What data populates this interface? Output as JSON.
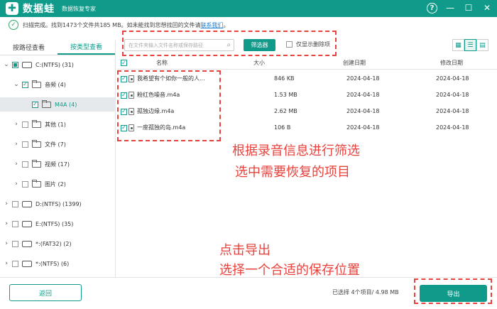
{
  "app": {
    "logo_char": "✚",
    "name": "数据蛙",
    "subtitle": "数据恢复专家",
    "accent": "#0f9a8a"
  },
  "window": {
    "help": "?",
    "minimize": "—",
    "maximize": "☐",
    "close": "✕"
  },
  "status": {
    "text": "扫描完成。找到1473个文件共185 MB。如未能找到您想找回的文件请",
    "link": "联系我们",
    "tail": "。"
  },
  "tabs": [
    "按路径查看",
    "按类型查看"
  ],
  "tree": [
    {
      "label": "C:(NTFS) (31)",
      "arrow": "v",
      "state": "partial",
      "icon": "drive"
    },
    {
      "label": "音频 (4)",
      "arrow": "v",
      "state": "checked",
      "icon": "folder"
    },
    {
      "label": "M4A (4)",
      "arrow": "",
      "state": "checked",
      "icon": "folder"
    },
    {
      "label": "其他 (1)",
      "arrow": ">",
      "state": "empty",
      "icon": "folder"
    },
    {
      "label": "文件 (7)",
      "arrow": ">",
      "state": "empty",
      "icon": "folder"
    },
    {
      "label": "视频 (17)",
      "arrow": ">",
      "state": "empty",
      "icon": "folder"
    },
    {
      "label": "图片 (2)",
      "arrow": ">",
      "state": "empty",
      "icon": "folder"
    },
    {
      "label": "D:(NTFS) (1399)",
      "arrow": ">",
      "state": "empty",
      "icon": "drive"
    },
    {
      "label": "E:(NTFS) (35)",
      "arrow": ">",
      "state": "empty",
      "icon": "drive"
    },
    {
      "label": "*:(FAT32) (2)",
      "arrow": ">",
      "state": "empty",
      "icon": "drive"
    },
    {
      "label": "*:(NTFS) (6)",
      "arrow": ">",
      "state": "empty",
      "icon": "drive"
    }
  ],
  "toolbar": {
    "search_placeholder": "在文件夹输入文件名称或保存路径",
    "filter_label": "筛选器",
    "show_deleted_label": "仅显示删除项"
  },
  "table": {
    "columns": [
      "名称",
      "大小",
      "创建日期",
      "修改日期"
    ],
    "rows": [
      {
        "name": "我希望有个如你一般的人...",
        "size": "846 KB",
        "created": "2024-04-18",
        "modified": "2024-04-18"
      },
      {
        "name": "粉红色噪音.m4a",
        "size": "1.53 MB",
        "created": "2024-04-18",
        "modified": "2024-04-18"
      },
      {
        "name": "孤独边缘.m4a",
        "size": "2.62 MB",
        "created": "2024-04-18",
        "modified": "2024-04-18"
      },
      {
        "name": "一座孤独的岛.m4a",
        "size": "106  B",
        "created": "2024-04-18",
        "modified": "2024-04-18"
      }
    ]
  },
  "annotations": {
    "line1": "根据录音信息进行筛选",
    "line2": "选中需要恢复的项目",
    "line3": "点击导出",
    "line4": "选择一个合适的保存位置",
    "color": "#e8423c"
  },
  "footer": {
    "back_label": "返回",
    "selection_info": "已选择 4个项目/ 4.98 MB",
    "export_label": "导出"
  }
}
